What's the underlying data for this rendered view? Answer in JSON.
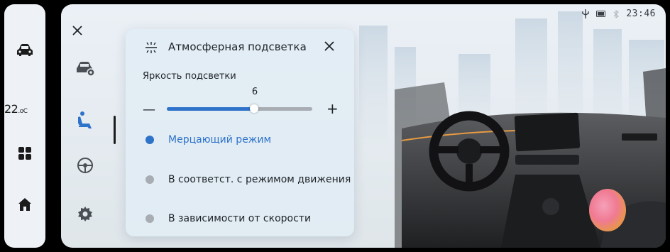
{
  "dock": {
    "temperature": "22",
    "temperature_unit": ".oC"
  },
  "status_bar": {
    "time": "23:46"
  },
  "popup": {
    "title": "Атмосферная подсветка",
    "brightness_label": "Яркость подсветки",
    "brightness_value": "6",
    "brightness_fraction": 0.6,
    "minus_label": "—",
    "plus_label": "+",
    "options": [
      {
        "label": "Мерцающий режим",
        "selected": true
      },
      {
        "label": "В соответст. с режимом движения",
        "selected": false
      },
      {
        "label": "В зависимости от скорости",
        "selected": false
      }
    ]
  },
  "colors": {
    "accent": "#2e73c9",
    "inactive_dot": "#a7adb2",
    "dock_bg": "#eef2f6"
  }
}
